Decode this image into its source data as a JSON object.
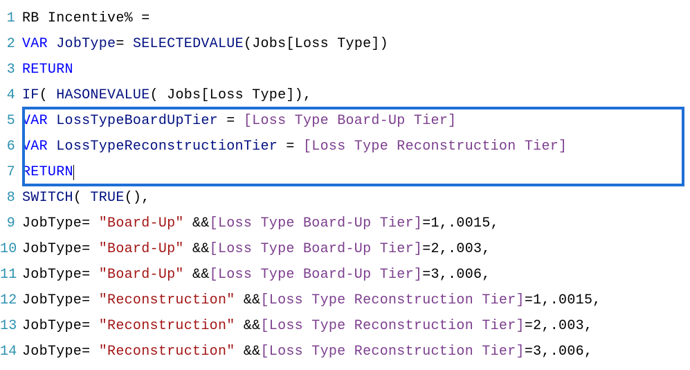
{
  "code": {
    "lines": [
      {
        "num": "1",
        "tokens": [
          {
            "t": "RB Incentive% ",
            "c": "tok-black"
          },
          {
            "t": "=",
            "c": "tok-black"
          }
        ]
      },
      {
        "num": "2",
        "tokens": [
          {
            "t": "VAR",
            "c": "tok-keyword"
          },
          {
            "t": " ",
            "c": "tok-black"
          },
          {
            "t": "JobType",
            "c": "tok-identifier"
          },
          {
            "t": "= ",
            "c": "tok-black"
          },
          {
            "t": "SELECTEDVALUE",
            "c": "tok-func"
          },
          {
            "t": "(Jobs[Loss Type])",
            "c": "tok-black"
          }
        ]
      },
      {
        "num": "3",
        "tokens": [
          {
            "t": "RETURN",
            "c": "tok-keyword"
          }
        ]
      },
      {
        "num": "4",
        "tokens": [
          {
            "t": "IF",
            "c": "tok-func"
          },
          {
            "t": "( ",
            "c": "tok-black"
          },
          {
            "t": "HASONEVALUE",
            "c": "tok-func"
          },
          {
            "t": "( Jobs[Loss Type]),",
            "c": "tok-black"
          }
        ]
      },
      {
        "num": "5",
        "tokens": [
          {
            "t": "VAR",
            "c": "tok-keyword"
          },
          {
            "t": " ",
            "c": "tok-black"
          },
          {
            "t": "LossTypeBoardUpTier",
            "c": "tok-identifier"
          },
          {
            "t": " = ",
            "c": "tok-black"
          },
          {
            "t": "[Loss Type Board-Up Tier]",
            "c": "tok-columnref"
          }
        ]
      },
      {
        "num": "6",
        "tokens": [
          {
            "t": "VAR",
            "c": "tok-keyword"
          },
          {
            "t": " ",
            "c": "tok-black"
          },
          {
            "t": "LossTypeReconstructionTier",
            "c": "tok-identifier"
          },
          {
            "t": " = ",
            "c": "tok-black"
          },
          {
            "t": "[Loss Type Reconstruction Tier]",
            "c": "tok-columnref"
          }
        ]
      },
      {
        "num": "7",
        "tokens": [
          {
            "t": "RETURN",
            "c": "tok-keyword"
          }
        ],
        "cursor": true
      },
      {
        "num": "8",
        "tokens": [
          {
            "t": "SWITCH",
            "c": "tok-func"
          },
          {
            "t": "( ",
            "c": "tok-black"
          },
          {
            "t": "TRUE",
            "c": "tok-func"
          },
          {
            "t": "(),",
            "c": "tok-black"
          }
        ]
      },
      {
        "num": "9",
        "tokens": [
          {
            "t": "JobType= ",
            "c": "tok-black"
          },
          {
            "t": "\"Board-Up\"",
            "c": "tok-string"
          },
          {
            "t": " &&",
            "c": "tok-black"
          },
          {
            "t": "[Loss Type Board-Up Tier]",
            "c": "tok-columnref"
          },
          {
            "t": "=1,.0015,",
            "c": "tok-black"
          }
        ]
      },
      {
        "num": "10",
        "tokens": [
          {
            "t": "JobType= ",
            "c": "tok-black"
          },
          {
            "t": "\"Board-Up\"",
            "c": "tok-string"
          },
          {
            "t": " &&",
            "c": "tok-black"
          },
          {
            "t": "[Loss Type Board-Up Tier]",
            "c": "tok-columnref"
          },
          {
            "t": "=2,.003,",
            "c": "tok-black"
          }
        ]
      },
      {
        "num": "11",
        "tokens": [
          {
            "t": "JobType= ",
            "c": "tok-black"
          },
          {
            "t": "\"Board-Up\"",
            "c": "tok-string"
          },
          {
            "t": " &&",
            "c": "tok-black"
          },
          {
            "t": "[Loss Type Board-Up Tier]",
            "c": "tok-columnref"
          },
          {
            "t": "=3,.006,",
            "c": "tok-black"
          }
        ]
      },
      {
        "num": "12",
        "tokens": [
          {
            "t": "JobType= ",
            "c": "tok-black"
          },
          {
            "t": "\"Reconstruction\"",
            "c": "tok-string"
          },
          {
            "t": " &&",
            "c": "tok-black"
          },
          {
            "t": "[Loss Type Reconstruction Tier]",
            "c": "tok-columnref"
          },
          {
            "t": "=1,.0015,",
            "c": "tok-black"
          }
        ]
      },
      {
        "num": "13",
        "tokens": [
          {
            "t": "JobType= ",
            "c": "tok-black"
          },
          {
            "t": "\"Reconstruction\"",
            "c": "tok-string"
          },
          {
            "t": " &&",
            "c": "tok-black"
          },
          {
            "t": "[Loss Type Reconstruction Tier]",
            "c": "tok-columnref"
          },
          {
            "t": "=2,.003,",
            "c": "tok-black"
          }
        ]
      },
      {
        "num": "14",
        "tokens": [
          {
            "t": "JobType= ",
            "c": "tok-black"
          },
          {
            "t": "\"Reconstruction\"",
            "c": "tok-string"
          },
          {
            "t": " &&",
            "c": "tok-black"
          },
          {
            "t": "[Loss Type Reconstruction Tier]",
            "c": "tok-columnref"
          },
          {
            "t": "=3,.006,",
            "c": "tok-black"
          }
        ]
      }
    ],
    "highlight": {
      "startLine": 5,
      "endLine": 7
    }
  }
}
